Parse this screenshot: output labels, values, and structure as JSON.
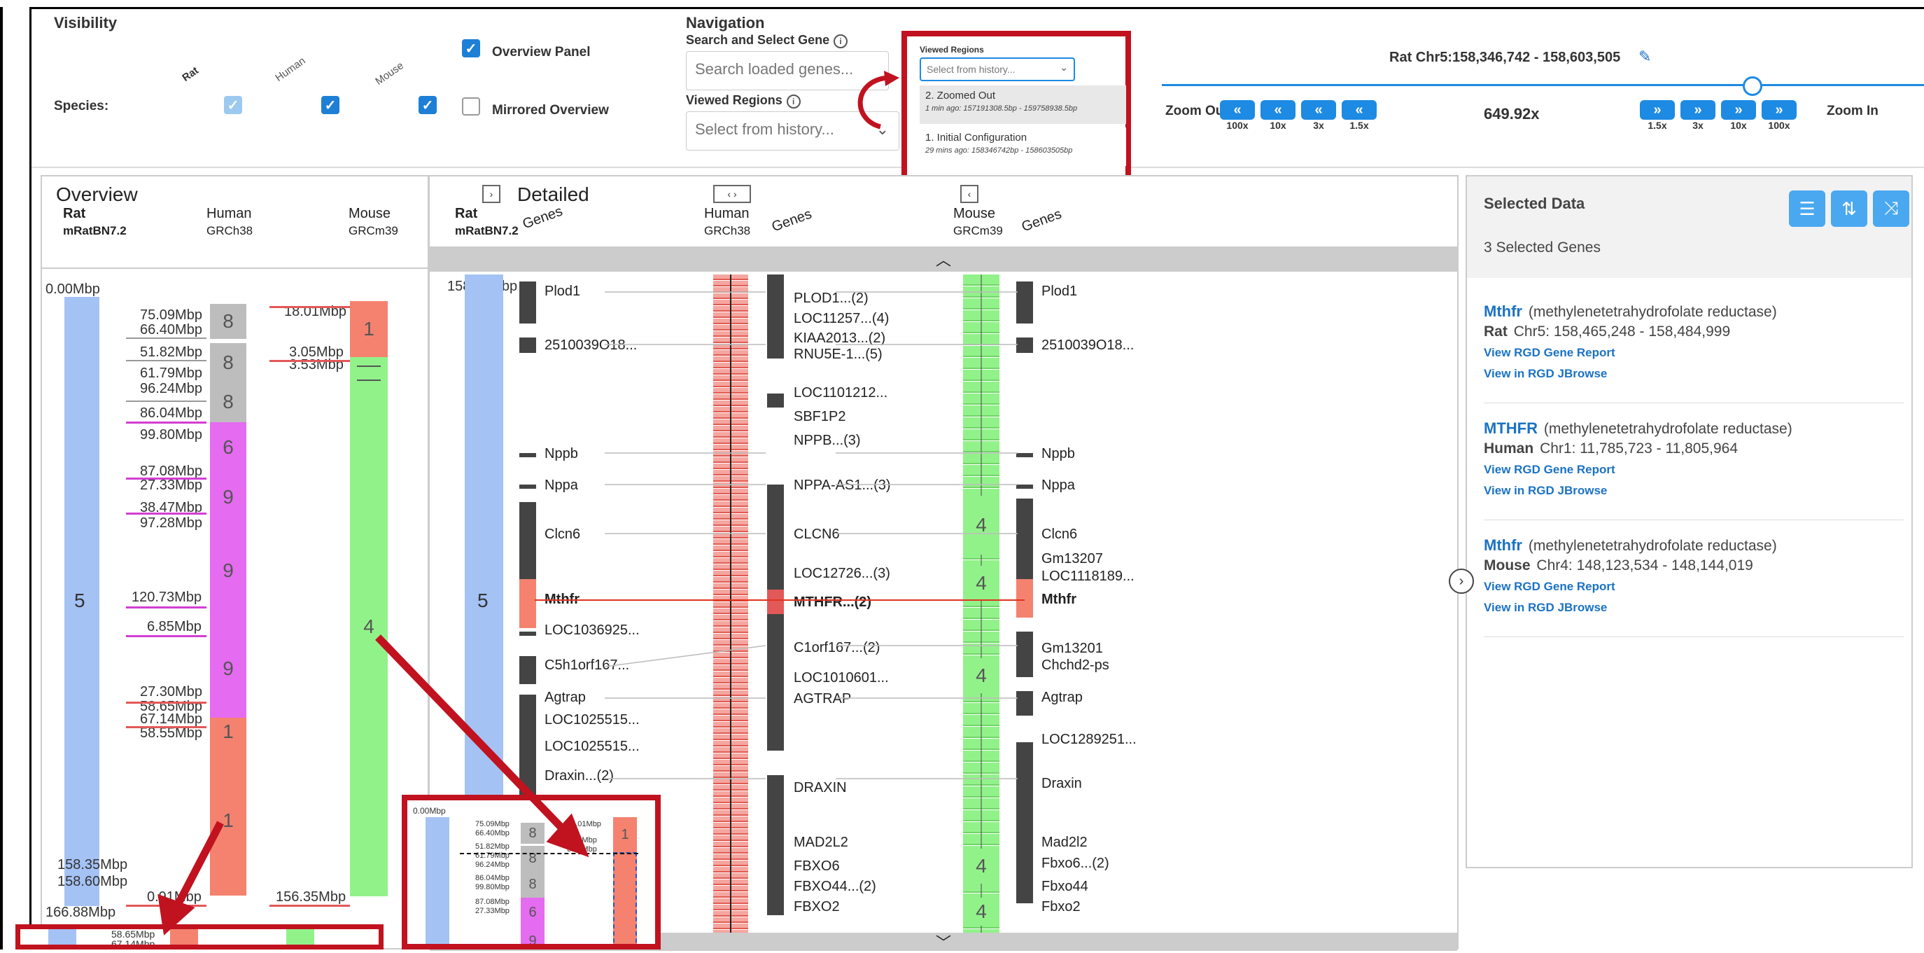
{
  "visibility": {
    "title": "Visibility",
    "species_label": "Species:",
    "species_cols": [
      "Rat",
      "Human",
      "Mouse"
    ],
    "overview_panel": "Overview Panel",
    "mirrored_overview": "Mirrored Overview"
  },
  "navigation": {
    "title": "Navigation",
    "search_label": "Search and Select Gene",
    "search_placeholder": "Search loaded genes...",
    "viewed_label": "Viewed Regions",
    "viewed_placeholder": "Select from history...",
    "popup_label": "Viewed Regions",
    "popup_placeholder": "Select from history...",
    "history": [
      {
        "title": "2. Zoomed Out",
        "detail": "1 min ago: 157191308.5bp - 159758938.5bp"
      },
      {
        "title": "1. Initial Configuration",
        "detail": "29 mins ago: 158346742bp - 158603505bp"
      }
    ]
  },
  "zoom": {
    "region": "Rat Chr5:158,346,742 - 158,603,505",
    "zoom_out": "Zoom Out",
    "zoom_in": "Zoom In",
    "level": "649.92x",
    "out_buttons": [
      "100x",
      "10x",
      "3x",
      "1.5x"
    ],
    "in_buttons": [
      "1.5x",
      "3x",
      "10x",
      "100x"
    ],
    "slider_pct": 82
  },
  "overview": {
    "title": "Overview",
    "species": [
      {
        "name": "Rat",
        "assembly": "mRatBN7.2"
      },
      {
        "name": "Human",
        "assembly": "GRCh38"
      },
      {
        "name": "Mouse",
        "assembly": "GRCm39"
      }
    ],
    "rat_start": "0.00Mbp",
    "rat_chr": "5",
    "rat_end1": "158.35Mbp",
    "rat_end2": "158.60Mbp",
    "rat_total": "166.88Mbp",
    "human_labels": [
      "75.09Mbp",
      "66.40Mbp",
      "51.82Mbp",
      "61.79Mbp",
      "96.24Mbp",
      "86.04Mbp",
      "99.80Mbp",
      "87.08Mbp",
      "27.33Mbp",
      "38.47Mbp",
      "97.28Mbp",
      "120.73Mbp",
      "6.85Mbp",
      "27.30Mbp",
      "58.65Mbp",
      "67.14Mbp",
      "58.55Mbp",
      "0.91Mbp"
    ],
    "human_chrs": [
      "8",
      "8",
      "8",
      "6",
      "9",
      "9",
      "9",
      "1",
      "1"
    ],
    "mouse_labels": [
      "18.01Mbp",
      "3.05Mbp",
      "3.53Mbp",
      "156.35Mbp"
    ],
    "mouse_chrs": [
      "1",
      "4"
    ]
  },
  "detailed": {
    "title": "Detailed",
    "species": [
      {
        "name": "Rat",
        "assembly": "mRatBN7.2"
      },
      {
        "name": "Human",
        "assembly": "GRCh38"
      },
      {
        "name": "Mouse",
        "assembly": "GRCm39"
      }
    ],
    "genes_label": "Genes",
    "start": "158.35Mbp",
    "rat_chr": "5",
    "rat_genes": [
      "Plod1",
      "2510039O18...",
      "Nppb",
      "Nppa",
      "Clcn6",
      "Mthfr",
      "LOC1036925...",
      "C5h1orf167...",
      "Agtrap",
      "LOC1025515...",
      "LOC1025515...",
      "Draxin...(2)"
    ],
    "human_genes": [
      "PLOD1...(2)",
      "LOC11257...(4)",
      "KIAA2013...(2)",
      "RNU5E-1...(5)",
      "LOC1101212...",
      "SBF1P2",
      "NPPB...(3)",
      "NPPA-AS1...(3)",
      "CLCN6",
      "LOC12726...(3)",
      "MTHFR...(2)",
      "C1orf167...(2)",
      "LOC1010601...",
      "AGTRAP",
      "DRAXIN",
      "MAD2L2",
      "FBXO6",
      "FBXO44...(2)",
      "FBXO2"
    ],
    "mouse_genes": [
      "Plod1",
      "2510039O18...",
      "Nppb",
      "Nppa",
      "Clcn6",
      "Gm13207",
      "LOC1118189...",
      "Mthfr",
      "Gm13201",
      "Chchd2-ps",
      "Agtrap",
      "LOC1289251...",
      "Draxin",
      "Mad2l2",
      "Fbxo6...(2)",
      "Fbxo44",
      "Fbxo2"
    ],
    "mouse_chr_labels": [
      "4",
      "4",
      "4",
      "4",
      "4"
    ]
  },
  "inset": {
    "start": "0.00Mbp",
    "labels": [
      "75.09Mbp",
      "66.40Mbp",
      "51.82Mbp",
      "61.79Mbp",
      "96.24Mbp",
      "86.04Mbp",
      "99.80Mbp",
      "87.08Mbp",
      "27.33Mbp"
    ],
    "mouse_labels": [
      "18.01Mbp",
      "3.05Mbp",
      "3.53Mbp"
    ],
    "chrs": [
      "8",
      "8",
      "8",
      "6",
      "9"
    ],
    "mouse_chr": "1"
  },
  "inset2": {
    "labels": [
      "58.65Mbp",
      "67.14Mbp"
    ]
  },
  "selected": {
    "title": "Selected Data",
    "count": "3 Selected Genes",
    "items": [
      {
        "gene": "Mthfr",
        "desc": "(methylenetetrahydrofolate reductase)",
        "species": "Rat",
        "loc": "Chr5: 158,465,248 - 158,484,999",
        "link1": "View RGD Gene Report",
        "link2": "View in RGD JBrowse"
      },
      {
        "gene": "MTHFR",
        "desc": "(methylenetetrahydrofolate reductase)",
        "species": "Human",
        "loc": "Chr1: 11,785,723 - 11,805,964",
        "link1": "View RGD Gene Report",
        "link2": "View in RGD JBrowse"
      },
      {
        "gene": "Mthfr",
        "desc": "(methylenetetrahydrofolate reductase)",
        "species": "Mouse",
        "loc": "Chr4: 148,123,534 - 148,144,019",
        "link1": "View RGD Gene Report",
        "link2": "View in RGD JBrowse"
      }
    ]
  },
  "colors": {
    "rat": "#a4c2f4",
    "human_gray": "#bdbdbd",
    "human_magenta": "#e56bf0",
    "human_salmon": "#f4826f",
    "mouse_green": "#92f28a",
    "accent": "#1d8ae3",
    "highlight_red": "#c1121f"
  }
}
